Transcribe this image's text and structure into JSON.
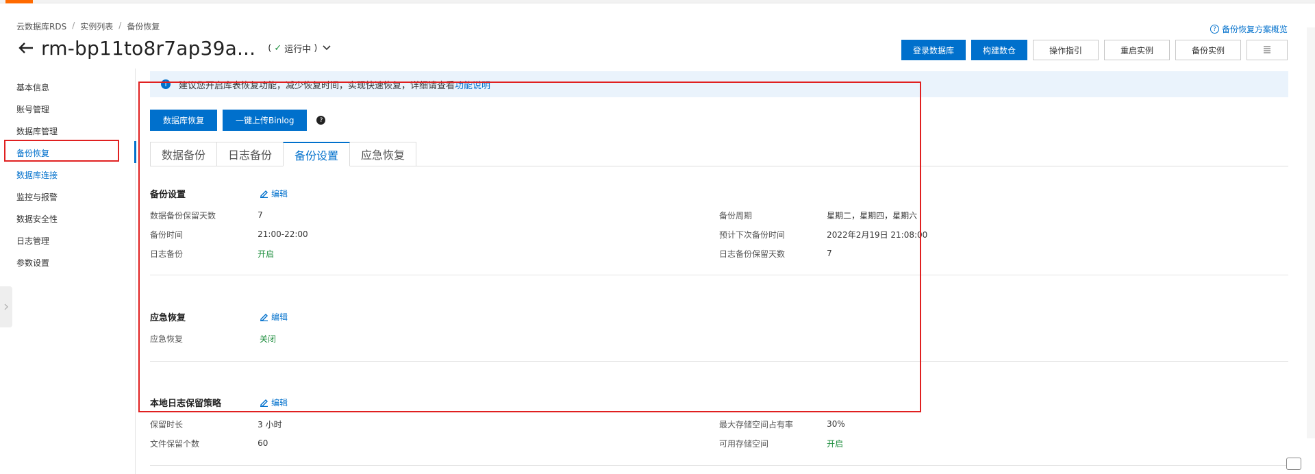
{
  "breadcrumb": [
    "云数据库RDS",
    "实例列表",
    "备份恢复"
  ],
  "breadcrumb_sep": "/",
  "instance": {
    "name": "rm-bp11to8r7ap39a...",
    "status": "运行中",
    "status_prefix": "(",
    "status_suffix": ")"
  },
  "help_link": "备份恢复方案概览",
  "actions": {
    "login_db": "登录数据库",
    "build_aggregate": "构建数仓",
    "guide": "操作指引",
    "restart": "重启实例",
    "backup_instance": "备份实例"
  },
  "sidebar": {
    "items": [
      "基本信息",
      "账号管理",
      "数据库管理",
      "备份恢复",
      "数据库连接",
      "监控与报警",
      "数据安全性",
      "日志管理",
      "参数设置"
    ]
  },
  "notice": {
    "text": "建议您开启库表恢复功能，减少恢复时间，实现快速恢复，详细请查看",
    "link": "功能说明"
  },
  "ops": {
    "db_restore": "数据库恢复",
    "upload_binlog": "一键上传Binlog"
  },
  "tabs": [
    "数据备份",
    "日志备份",
    "备份设置",
    "应急恢复"
  ],
  "edit_label": "编辑",
  "backup_settings": {
    "title": "备份设置",
    "left": [
      {
        "label": "数据备份保留天数",
        "value": "7"
      },
      {
        "label": "备份时间",
        "value": "21:00-22:00"
      },
      {
        "label": "日志备份",
        "value": "开启"
      }
    ],
    "right": [
      {
        "label": "备份周期",
        "value": "星期二，星期四，星期六"
      },
      {
        "label": "预计下次备份时间",
        "value": "2022年2月19日 21:08:00"
      },
      {
        "label": "日志备份保留天数",
        "value": "7"
      }
    ]
  },
  "emergency": {
    "title": "应急恢复",
    "rows": [
      {
        "label": "应急恢复",
        "value": "关闭"
      }
    ]
  },
  "local_log": {
    "title": "本地日志保留策略",
    "left": [
      {
        "label": "保留时长",
        "value": "3 小时"
      },
      {
        "label": "文件保留个数",
        "value": "60"
      }
    ],
    "right": [
      {
        "label": "最大存储空间占有率",
        "value": "30%"
      },
      {
        "label": "可用存储空间",
        "value": "开启"
      }
    ]
  },
  "colors": {
    "brand": "#0070cc",
    "success": "#1e8e3e",
    "highlight": "#e02020"
  }
}
